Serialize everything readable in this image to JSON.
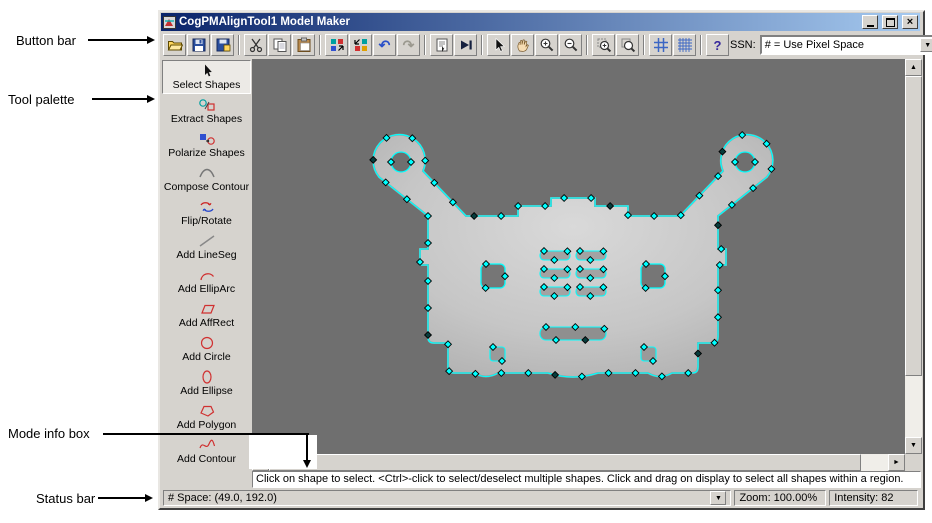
{
  "annotations": {
    "button_bar": "Button bar",
    "tool_palette": "Tool palette",
    "mode_info_box": "Mode info box",
    "status_bar": "Status bar"
  },
  "window": {
    "title": "CogPMAlignTool1 Model Maker",
    "controls": [
      "minimize",
      "maximize",
      "close"
    ]
  },
  "toolbar": {
    "ssn_label": "SSN:",
    "ssn_value": "# = Use Pixel Space",
    "icons": [
      "open",
      "save",
      "export-image",
      "cut",
      "copy",
      "paste",
      "shapes-forward",
      "shapes-backward",
      "undo",
      "redo",
      "properties",
      "run-mode",
      "select-cursor",
      "pan-hand",
      "zoom-in",
      "zoom-out",
      "zoom-region",
      "zoom-fit",
      "grid-axes",
      "grid-dense",
      "help"
    ]
  },
  "palette": {
    "items": [
      {
        "label": "Select Shapes",
        "pressed": true
      },
      {
        "label": "Extract Shapes"
      },
      {
        "label": "Polarize Shapes"
      },
      {
        "label": "Compose Contour"
      },
      {
        "label": "Flip/Rotate"
      },
      {
        "label": "Add LineSeg"
      },
      {
        "label": "Add EllipArc"
      },
      {
        "label": "Add AffRect"
      },
      {
        "label": "Add Circle"
      },
      {
        "label": "Add Ellipse"
      },
      {
        "label": "Add Polygon"
      },
      {
        "label": "Add Contour"
      }
    ]
  },
  "mode_info": {
    "text": "Click on shape to select. <Ctrl>-click to select/deselect multiple shapes. Click and drag on display to select all shapes within a region."
  },
  "status_bar": {
    "space": "# Space:  (49.0, 192.0)",
    "zoom": "Zoom:  100.00%",
    "intensity": "Intensity: 82"
  },
  "colors": {
    "selection_cyan": "#00ffff",
    "titlebar_left": "#0a246a",
    "titlebar_right": "#a6caf0",
    "chrome": "#d6d3ce",
    "canvas_bg": "#6f6f6f"
  }
}
